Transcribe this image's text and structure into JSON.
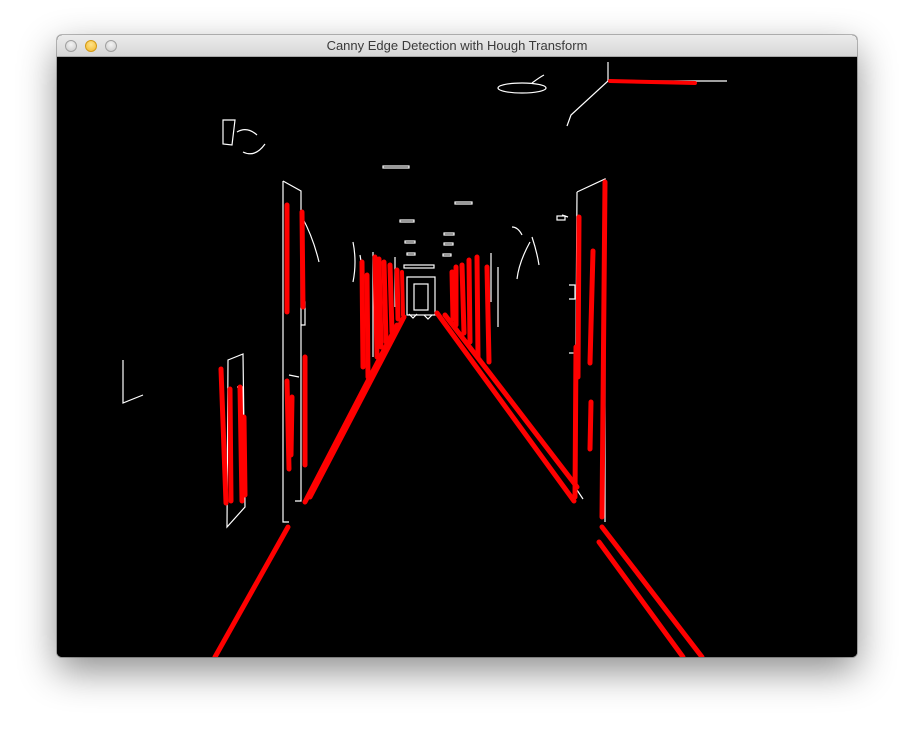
{
  "window": {
    "title": "Canny Edge Detection with Hough Transform"
  },
  "colors": {
    "background": "#000000",
    "edges": "#ffffff",
    "hough_lines": "#ff0000",
    "titlebar": "#e0e0e0"
  },
  "icons": [
    "close-button",
    "minimize-button",
    "zoom-button"
  ]
}
